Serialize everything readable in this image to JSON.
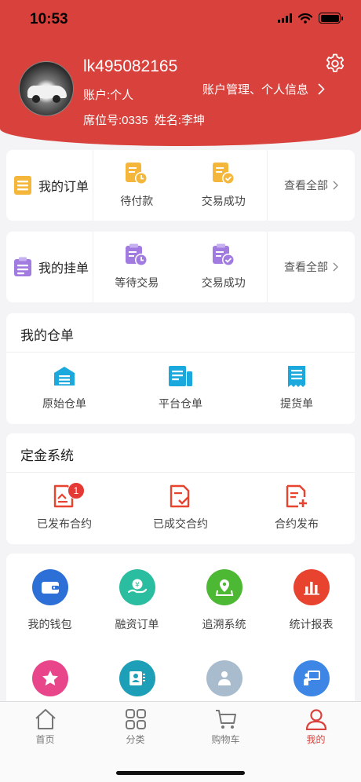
{
  "status_bar": {
    "time": "10:53"
  },
  "profile": {
    "username": "lk495082165",
    "account_type": "账户:个人",
    "seat_and_name": "席位号:0335  姓名:李坤",
    "manage_link": "账户管理、个人信息"
  },
  "my_orders": {
    "title": "我的订单",
    "items": [
      {
        "label": "待付款"
      },
      {
        "label": "交易成功"
      }
    ],
    "view_all": "查看全部"
  },
  "my_listings": {
    "title": "我的挂单",
    "items": [
      {
        "label": "等待交易"
      },
      {
        "label": "交易成功"
      }
    ],
    "view_all": "查看全部"
  },
  "warehouse": {
    "title": "我的仓单",
    "items": [
      {
        "label": "原始仓单"
      },
      {
        "label": "平台仓单"
      },
      {
        "label": "提货单"
      }
    ]
  },
  "deposit": {
    "title": "定金系统",
    "items": [
      {
        "label": "已发布合约",
        "badge": "1"
      },
      {
        "label": "已成交合约"
      },
      {
        "label": "合约发布"
      }
    ]
  },
  "services": {
    "items": [
      {
        "label": "我的钱包",
        "color": "#2c6fd6"
      },
      {
        "label": "融资订单",
        "color": "#2bbd9f"
      },
      {
        "label": "追溯系统",
        "color": "#4cb834"
      },
      {
        "label": "统计报表",
        "color": "#e8432f"
      }
    ],
    "row2_colors": [
      "#e8458b",
      "#1e9fb8",
      "#a9bccd",
      "#3e86e6"
    ]
  },
  "tabbar": {
    "tabs": [
      {
        "label": "首页"
      },
      {
        "label": "分类"
      },
      {
        "label": "购物车"
      },
      {
        "label": "我的"
      }
    ],
    "active_color": "#d9423c"
  }
}
